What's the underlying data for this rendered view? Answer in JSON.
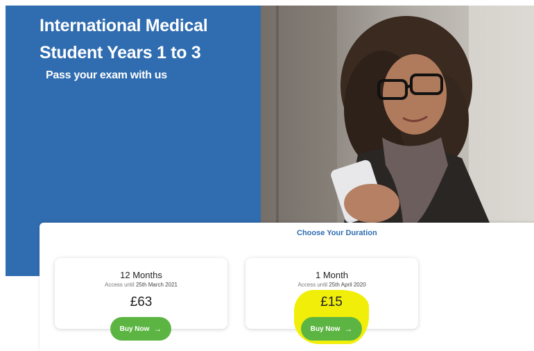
{
  "hero": {
    "title": "International Medical Student Years 1 to 3",
    "subtitle": "Pass your exam with us",
    "brand_color": "#2f6cb0"
  },
  "pricing": {
    "heading": "Choose Your Duration",
    "plans": [
      {
        "name": "12 Months",
        "access_prefix": "Access until",
        "access_date": "25th March 2021",
        "price": "£63",
        "button_label": "Buy Now"
      },
      {
        "name": "1 Month",
        "access_prefix": "Access until",
        "access_date": "25th April 2020",
        "price": "£15",
        "button_label": "Buy Now"
      }
    ],
    "button_color": "#5cb543",
    "highlight_color": "#f1ee0a"
  },
  "icons": {
    "arrow": "arrow-right-icon"
  }
}
